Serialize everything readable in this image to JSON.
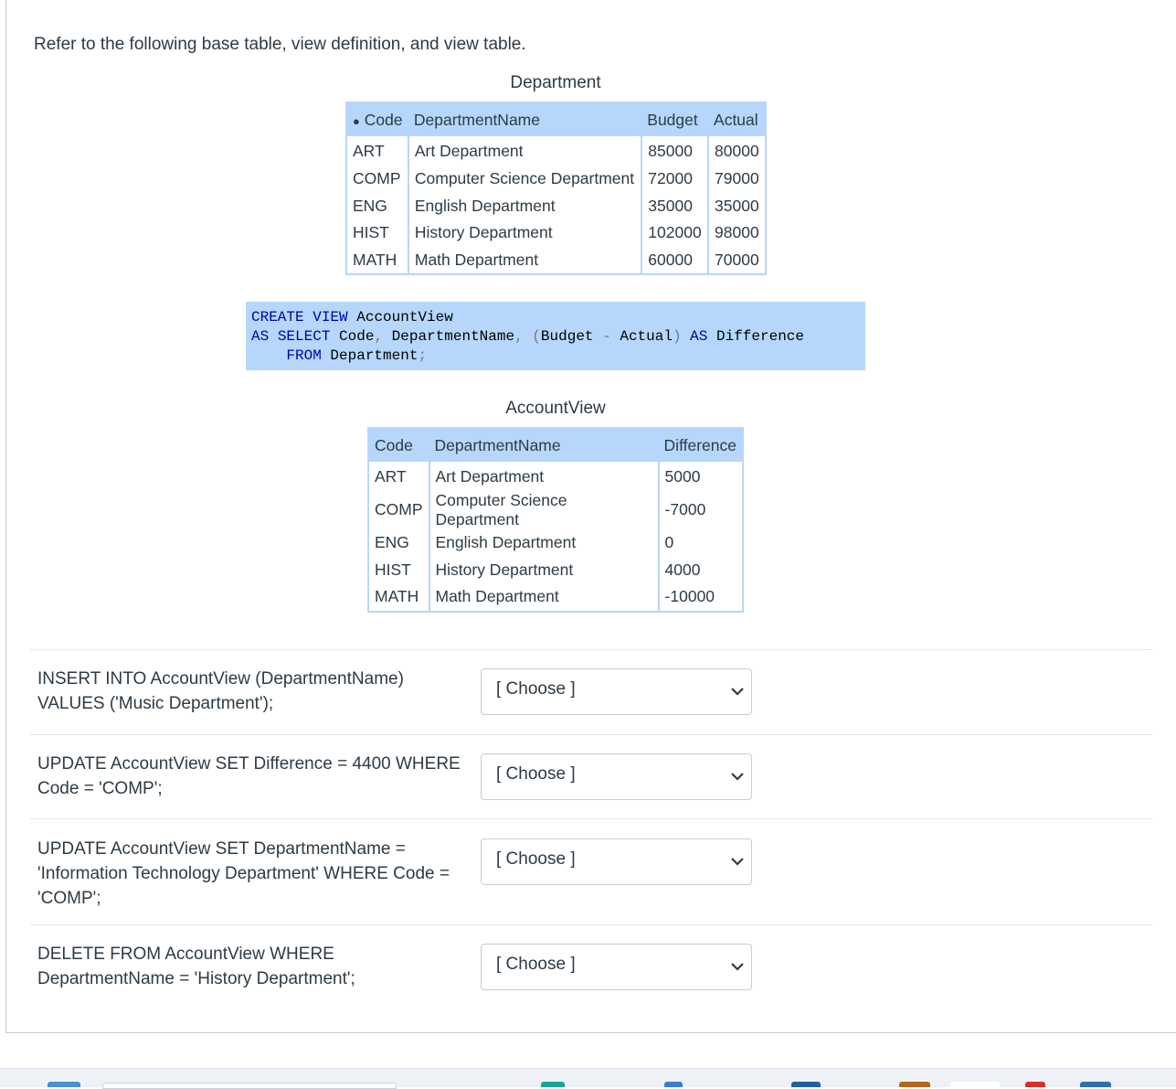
{
  "intro": "Refer to the following base table, view definition, and view table.",
  "department": {
    "caption": "Department",
    "key_marker": "●",
    "headers": [
      "Code",
      "DepartmentName",
      "Budget",
      "Actual"
    ],
    "rows": [
      [
        "ART",
        "Art Department",
        "85000",
        "80000"
      ],
      [
        "COMP",
        "Computer Science Department",
        "72000",
        "79000"
      ],
      [
        "ENG",
        "English Department",
        "35000",
        "35000"
      ],
      [
        "HIST",
        "History Department",
        "102000",
        "98000"
      ],
      [
        "MATH",
        "Math Department",
        "60000",
        "70000"
      ]
    ]
  },
  "view_sql": {
    "kw_create": "CREATE",
    "kw_view": "VIEW",
    "view_name": "AccountView",
    "kw_as": "AS",
    "kw_select": "SELECT",
    "col_code": "Code",
    "col_deptname": "DepartmentName",
    "col_budget": "Budget",
    "op_minus": "-",
    "col_actual": "Actual",
    "kw_as2": "AS",
    "alias": "Difference",
    "kw_from": "FROM",
    "table_name": "Department"
  },
  "account_view": {
    "caption": "AccountView",
    "headers": [
      "Code",
      "DepartmentName",
      "Difference"
    ],
    "rows": [
      [
        "ART",
        "Art Department",
        "5000"
      ],
      [
        "COMP",
        "Computer Science Department",
        "-7000"
      ],
      [
        "ENG",
        "English Department",
        "0"
      ],
      [
        "HIST",
        "History Department",
        "4000"
      ],
      [
        "MATH",
        "Math Department",
        "-10000"
      ]
    ]
  },
  "questions": [
    {
      "text": "INSERT INTO AccountView (DepartmentName) VALUES ('Music Department');",
      "selected": "[ Choose ]"
    },
    {
      "text": "UPDATE AccountView SET Difference = 4400 WHERE Code = 'COMP';",
      "selected": "[ Choose ]"
    },
    {
      "text": "UPDATE AccountView SET DepartmentName = 'Information Technology Department' WHERE Code = 'COMP';",
      "selected": "[ Choose ]"
    },
    {
      "text": "DELETE FROM AccountView WHERE DepartmentName = 'History Department';",
      "selected": "[ Choose ]"
    }
  ],
  "colors": {
    "table_accent": "#b6d7fb",
    "sql_keyword": "#0000aa",
    "text": "#2d3b45"
  },
  "icons": {
    "select_arrow": "chevron-down-icon"
  }
}
